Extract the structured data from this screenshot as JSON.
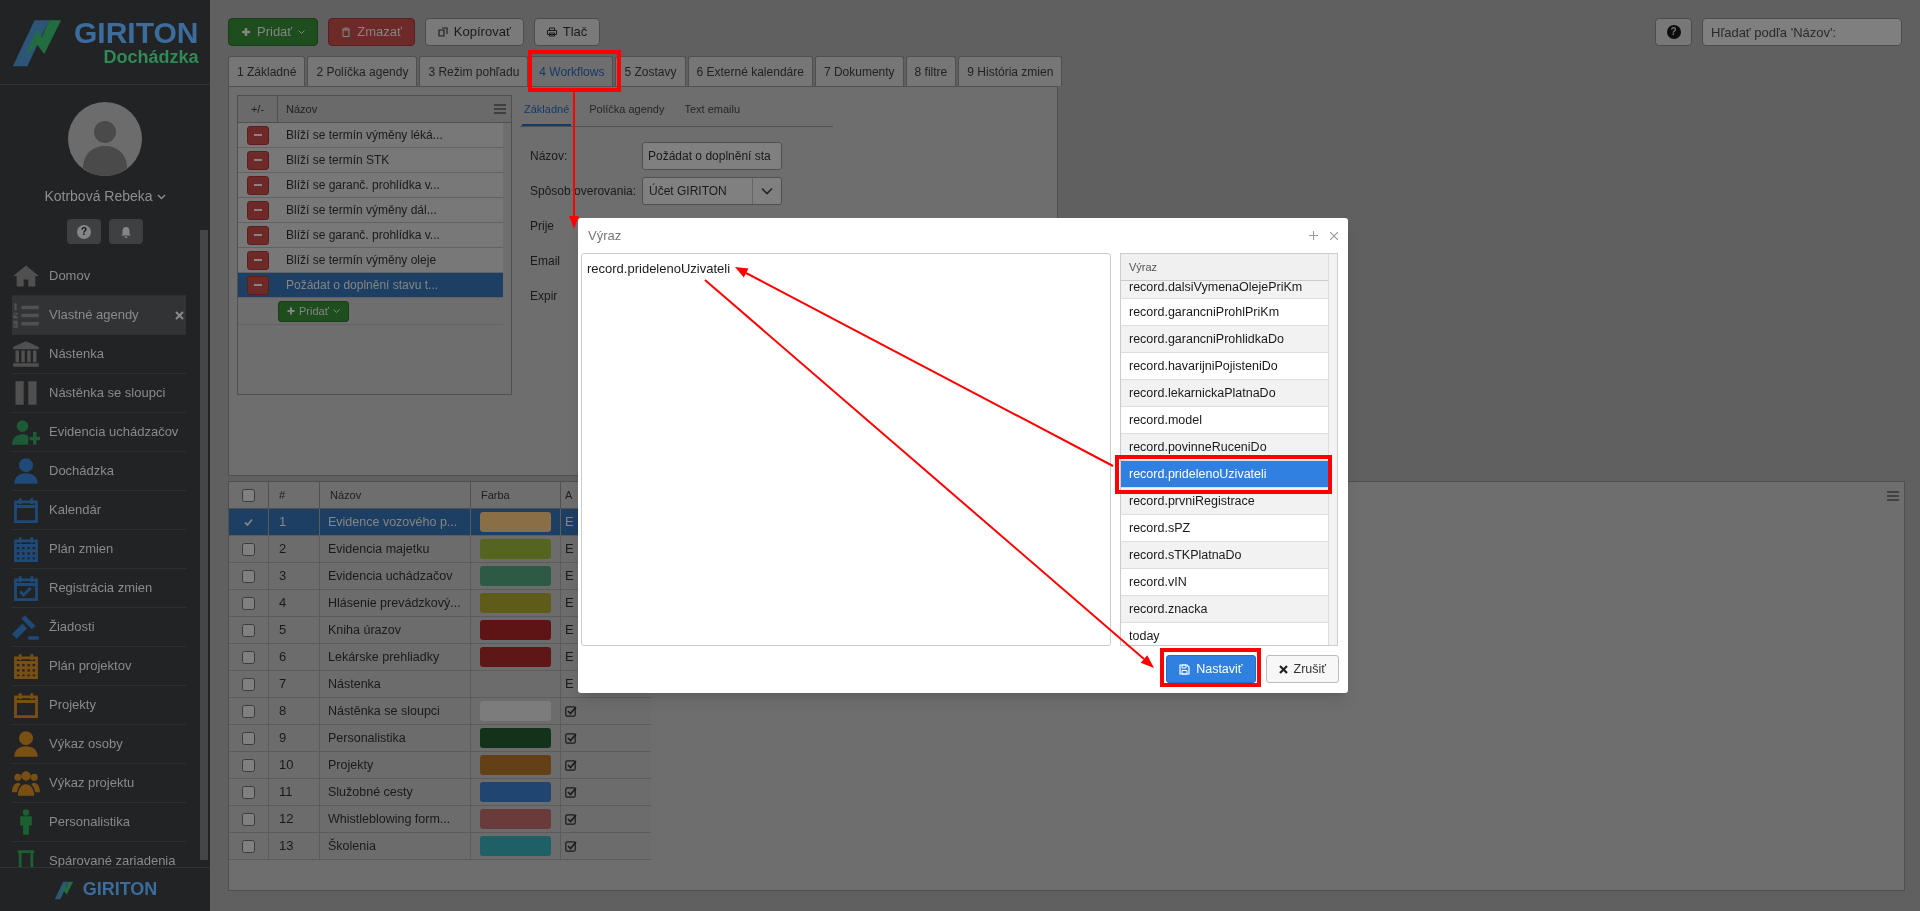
{
  "sidebar": {
    "logo": {
      "brand": "GIRITON",
      "product": "Dochádzka"
    },
    "user": "Kotrbová Rebeka",
    "items": [
      {
        "label": "Domov",
        "color": "#505050",
        "selected": false,
        "closable": false
      },
      {
        "label": "Vlastné agendy",
        "color": "#505050",
        "selected": true,
        "closable": true
      },
      {
        "label": "Nástenka",
        "color": "#505050",
        "selected": false,
        "closable": false
      },
      {
        "label": "Nástěnka se sloupci",
        "color": "#505050",
        "selected": false,
        "closable": false
      },
      {
        "label": "Evidencia uchádzačov",
        "color": "#1d5a36",
        "selected": false,
        "closable": false
      },
      {
        "label": "Dochádzka",
        "color": "#1f4a78",
        "selected": false,
        "closable": false
      },
      {
        "label": "Kalendár",
        "color": "#1f4a78",
        "selected": false,
        "closable": false
      },
      {
        "label": "Plán zmien",
        "color": "#1f4a78",
        "selected": false,
        "closable": false
      },
      {
        "label": "Registrácia zmien",
        "color": "#1f4a78",
        "selected": false,
        "closable": false
      },
      {
        "label": "Žiadosti",
        "color": "#1f4a78",
        "selected": false,
        "closable": false
      },
      {
        "label": "Plán projektov",
        "color": "#7a4f14",
        "selected": false,
        "closable": false
      },
      {
        "label": "Projekty",
        "color": "#7a4f14",
        "selected": false,
        "closable": false
      },
      {
        "label": "Výkaz osoby",
        "color": "#7a4f14",
        "selected": false,
        "closable": false
      },
      {
        "label": "Výkaz projektu",
        "color": "#7a4f14",
        "selected": false,
        "closable": false
      },
      {
        "label": "Personalistika",
        "color": "#1a6030",
        "selected": false,
        "closable": false
      },
      {
        "label": "Spárované zariadenia",
        "color": "#1a6030",
        "selected": false,
        "closable": false
      }
    ],
    "footer_logo": "GIRITON",
    "help_icon": "?"
  },
  "toolbar": {
    "buttons": [
      {
        "label": "Pridať",
        "kind": "add"
      },
      {
        "label": "Zmazať",
        "kind": "delete"
      },
      {
        "label": "Kopírovať",
        "kind": "copy"
      },
      {
        "label": "Tlač",
        "kind": "print"
      }
    ],
    "search": {
      "placeholder": "Hľadať podľa 'Názov':"
    },
    "help_icon": "?"
  },
  "tabs": [
    {
      "label": "1 Základné",
      "selected": false
    },
    {
      "label": "2 Políčka agendy",
      "selected": false
    },
    {
      "label": "3 Režim pohľadu",
      "selected": false
    },
    {
      "label": "4 Workflows",
      "selected": true
    },
    {
      "label": "5 Zostavy",
      "selected": false
    },
    {
      "label": "6 Externé kalendáre",
      "selected": false
    },
    {
      "label": "7 Dokumenty",
      "selected": false
    },
    {
      "label": "8 filtre",
      "selected": false
    },
    {
      "label": "9 História zmien",
      "selected": false
    }
  ],
  "workflows": {
    "columns": [
      "+/-",
      "Názov"
    ],
    "rows": [
      {
        "name": "Blíží se termín výměny léká...",
        "selected": false
      },
      {
        "name": "Blíží se termín STK",
        "selected": false
      },
      {
        "name": "Blíží se garanč. prohlídka v...",
        "selected": false
      },
      {
        "name": "Blíží se termín výměny dál...",
        "selected": false
      },
      {
        "name": "Blíží se garanč. prohlídka v...",
        "selected": false
      },
      {
        "name": "Blíží se termín výměny oleje",
        "selected": false
      },
      {
        "name": "Požádat o doplnění stavu t...",
        "selected": true
      }
    ],
    "add_button": "Pridať"
  },
  "subtabs": [
    {
      "label": "Základné",
      "selected": true
    },
    {
      "label": "Políčka agendy",
      "selected": false
    },
    {
      "label": "Text emailu",
      "selected": false
    }
  ],
  "form": {
    "fields": [
      {
        "label": "Názov:",
        "kind": "text",
        "value": "Požádat o doplnění sta"
      },
      {
        "label": "Spôsob overovania:",
        "kind": "select",
        "value": "Účet GIRITON"
      },
      {
        "label": "Prije",
        "kind": "label"
      },
      {
        "label": "Email",
        "kind": "label"
      },
      {
        "label": "Expir",
        "kind": "label"
      }
    ]
  },
  "table": {
    "select_all": false,
    "columns": [
      "#",
      "Názov",
      "Farba",
      "A"
    ],
    "rows": [
      {
        "number": "1",
        "name": "Evidence vozového p...",
        "color": "#8a6e45",
        "column_4": "E",
        "selected": true
      },
      {
        "number": "2",
        "name": "Evidencia majetku",
        "color": "#55641e",
        "column_4": "E",
        "selected": false
      },
      {
        "number": "3",
        "name": "Evidencia uchádzačov",
        "color": "#2c5a45",
        "column_4": "E",
        "selected": false
      },
      {
        "number": "4",
        "name": "Hlásenie prevádzkový...",
        "color": "#5e5c18",
        "column_4": "E",
        "selected": false
      },
      {
        "number": "5",
        "name": "Kniha úrazov",
        "color": "#5e1414",
        "column_4": "E",
        "selected": false
      },
      {
        "number": "6",
        "name": "Lekárske prehliadky",
        "color": "#5e1616",
        "column_4": "E",
        "selected": false
      },
      {
        "number": "7",
        "name": "Nástenka",
        "column_4": "E",
        "selected": false
      },
      {
        "number": "8",
        "name": "Nástěnka se sloupci",
        "color": "#7c7c7c",
        "flag_checked": true,
        "selected": false
      },
      {
        "number": "9",
        "name": "Personalistika",
        "color": "#12331a",
        "flag_checked": true,
        "selected": false
      },
      {
        "number": "10",
        "name": "Projekty",
        "color": "#644017",
        "flag_checked": true,
        "selected": false
      },
      {
        "number": "11",
        "name": "Služobné cesty",
        "color": "#1f4570",
        "flag_checked": true,
        "selected": false
      },
      {
        "number": "12",
        "name": "Whistleblowing form...",
        "color": "#6a3b3b",
        "flag_checked": true,
        "selected": false
      },
      {
        "number": "13",
        "name": "Školenia",
        "color": "#1f6066",
        "flag_checked": true,
        "selected": false
      }
    ]
  },
  "dialog": {
    "title": "Výraz",
    "expression": "record.pridelenoUzivateli",
    "list": {
      "header": "Výraz",
      "items": [
        {
          "text": "record.dalsiVymenaOlejePriKm",
          "selected": false
        },
        {
          "text": "record.garancniProhlPriKm",
          "selected": false
        },
        {
          "text": "record.garancniProhlidkaDo",
          "selected": false
        },
        {
          "text": "record.havarijniPojisteniDo",
          "selected": false
        },
        {
          "text": "record.lekarnickaPlatnaDo",
          "selected": false
        },
        {
          "text": "record.model",
          "selected": false
        },
        {
          "text": "record.povinneRuceniDo",
          "selected": false
        },
        {
          "text": "record.pridelenoUzivateli",
          "selected": true
        },
        {
          "text": "record.prvniRegistrace",
          "selected": false
        },
        {
          "text": "record.sPZ",
          "selected": false
        },
        {
          "text": "record.sTKPlatnaDo",
          "selected": false
        },
        {
          "text": "record.vIN",
          "selected": false
        },
        {
          "text": "record.znacka",
          "selected": false
        },
        {
          "text": "today",
          "selected": false
        }
      ]
    },
    "buttons": [
      {
        "label": "Nastaviť",
        "kind": "primary"
      },
      {
        "label": "Zrušiť",
        "kind": "cancel"
      }
    ]
  }
}
